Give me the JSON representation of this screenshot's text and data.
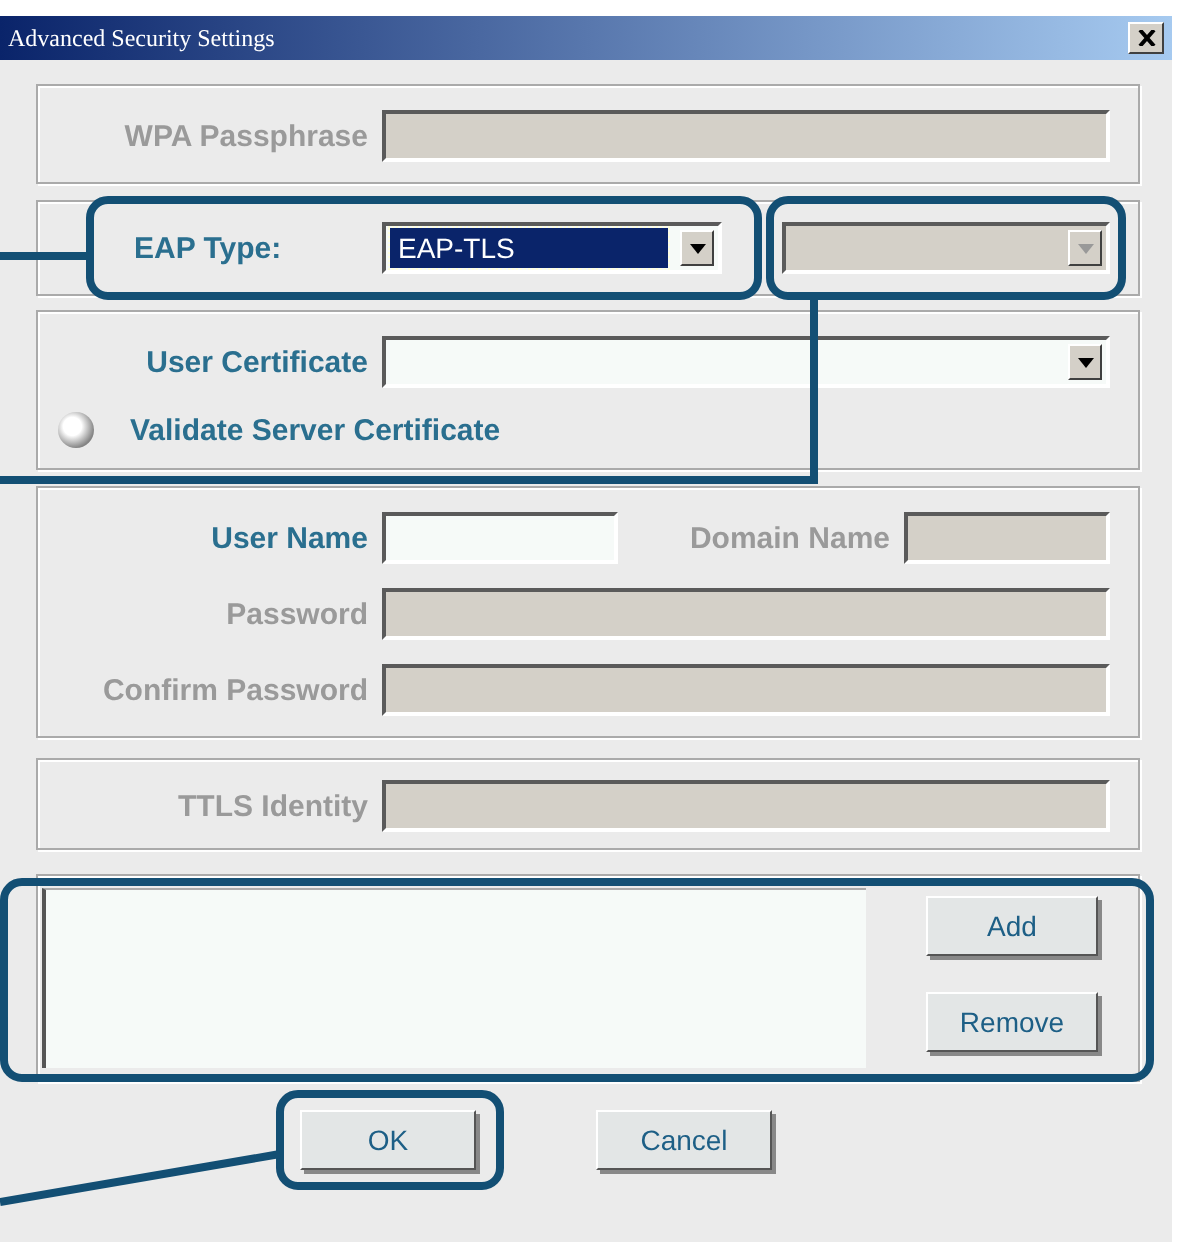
{
  "window": {
    "title": "Advanced Security Settings"
  },
  "wpa_passphrase": {
    "label": "WPA Passphrase",
    "disabled": true
  },
  "eap_type": {
    "label": "EAP Type:",
    "value": "EAP-TLS",
    "focused": true
  },
  "inner_method": {
    "disabled": true
  },
  "user_certificate": {
    "label": "User Certificate",
    "disabled": false
  },
  "validate_server_certificate": {
    "label": "Validate Server Certificate",
    "checked": false
  },
  "user_name": {
    "label": "User Name",
    "disabled": false
  },
  "domain_name": {
    "label": "Domain Name",
    "disabled": true
  },
  "password": {
    "label": "Password",
    "disabled": true
  },
  "confirm_password": {
    "label": "Confirm Password",
    "disabled": true
  },
  "ttls_identity": {
    "label": "TTLS Identity",
    "disabled": true
  },
  "list_buttons": [
    "Add",
    "Remove"
  ],
  "buttons": [
    "OK",
    "Cancel"
  ]
}
